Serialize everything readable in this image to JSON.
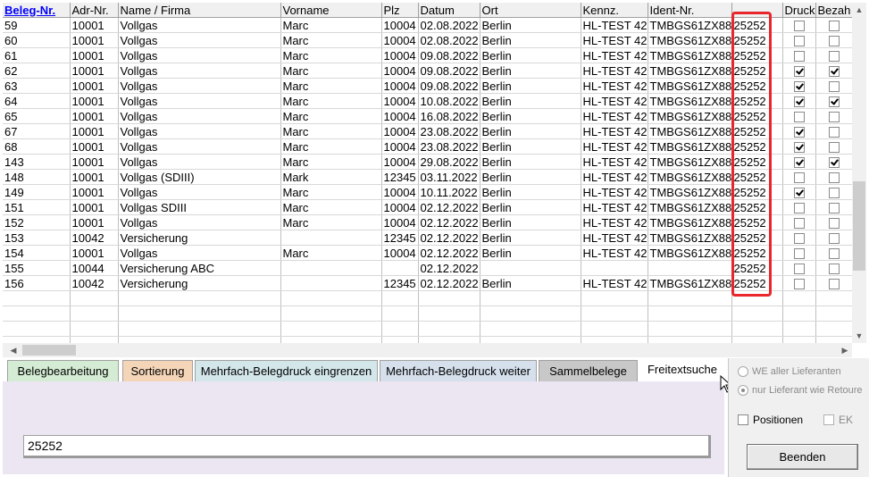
{
  "grid": {
    "columns": [
      "Beleg-Nr.",
      "Adr-Nr.",
      "Name / Firma",
      "Vorname",
      "Plz",
      "Datum",
      "Ort",
      "Kennz.",
      "Ident-Nr.",
      "",
      "Druck",
      "Bezah"
    ],
    "rows": [
      {
        "beleg": "59",
        "adr": "10001",
        "name": "Vollgas",
        "vorname": "Marc",
        "plz": "10004",
        "datum": "02.08.2022",
        "ort": "Berlin",
        "kennz": "HL-TEST 42",
        "ident": "TMBGS61ZX88",
        "value": "25252",
        "druck": false,
        "bezahlt": false
      },
      {
        "beleg": "60",
        "adr": "10001",
        "name": "Vollgas",
        "vorname": "Marc",
        "plz": "10004",
        "datum": "02.08.2022",
        "ort": "Berlin",
        "kennz": "HL-TEST 42",
        "ident": "TMBGS61ZX88",
        "value": "25252",
        "druck": false,
        "bezahlt": false
      },
      {
        "beleg": "61",
        "adr": "10001",
        "name": "Vollgas",
        "vorname": "Marc",
        "plz": "10004",
        "datum": "09.08.2022",
        "ort": "Berlin",
        "kennz": "HL-TEST 42",
        "ident": "TMBGS61ZX88",
        "value": "25252",
        "druck": false,
        "bezahlt": false
      },
      {
        "beleg": "62",
        "adr": "10001",
        "name": "Vollgas",
        "vorname": "Marc",
        "plz": "10004",
        "datum": "09.08.2022",
        "ort": "Berlin",
        "kennz": "HL-TEST 42",
        "ident": "TMBGS61ZX88",
        "value": "25252",
        "druck": true,
        "bezahlt": true
      },
      {
        "beleg": "63",
        "adr": "10001",
        "name": "Vollgas",
        "vorname": "Marc",
        "plz": "10004",
        "datum": "09.08.2022",
        "ort": "Berlin",
        "kennz": "HL-TEST 42",
        "ident": "TMBGS61ZX88",
        "value": "25252",
        "druck": true,
        "bezahlt": false
      },
      {
        "beleg": "64",
        "adr": "10001",
        "name": "Vollgas",
        "vorname": "Marc",
        "plz": "10004",
        "datum": "10.08.2022",
        "ort": "Berlin",
        "kennz": "HL-TEST 42",
        "ident": "TMBGS61ZX88",
        "value": "25252",
        "druck": true,
        "bezahlt": true
      },
      {
        "beleg": "65",
        "adr": "10001",
        "name": "Vollgas",
        "vorname": "Marc",
        "plz": "10004",
        "datum": "16.08.2022",
        "ort": "Berlin",
        "kennz": "HL-TEST 42",
        "ident": "TMBGS61ZX88",
        "value": "25252",
        "druck": false,
        "bezahlt": false
      },
      {
        "beleg": "67",
        "adr": "10001",
        "name": "Vollgas",
        "vorname": "Marc",
        "plz": "10004",
        "datum": "23.08.2022",
        "ort": "Berlin",
        "kennz": "HL-TEST 42",
        "ident": "TMBGS61ZX88",
        "value": "25252",
        "druck": true,
        "bezahlt": false
      },
      {
        "beleg": "68",
        "adr": "10001",
        "name": "Vollgas",
        "vorname": "Marc",
        "plz": "10004",
        "datum": "23.08.2022",
        "ort": "Berlin",
        "kennz": "HL-TEST 42",
        "ident": "TMBGS61ZX88",
        "value": "25252",
        "druck": true,
        "bezahlt": false
      },
      {
        "beleg": "143",
        "adr": "10001",
        "name": "Vollgas",
        "vorname": "Marc",
        "plz": "10004",
        "datum": "29.08.2022",
        "ort": "Berlin",
        "kennz": "HL-TEST 42",
        "ident": "TMBGS61ZX88",
        "value": "25252",
        "druck": true,
        "bezahlt": true
      },
      {
        "beleg": "148",
        "adr": "10001",
        "name": "Vollgas (SDIII)",
        "vorname": "Mark",
        "plz": "12345",
        "datum": "03.11.2022",
        "ort": "Berlin",
        "kennz": "HL-TEST 42",
        "ident": "TMBGS61ZX88",
        "value": "25252",
        "druck": false,
        "bezahlt": false
      },
      {
        "beleg": "149",
        "adr": "10001",
        "name": "Vollgas",
        "vorname": "Marc",
        "plz": "10004",
        "datum": "10.11.2022",
        "ort": "Berlin",
        "kennz": "HL-TEST 42",
        "ident": "TMBGS61ZX88",
        "value": "25252",
        "druck": true,
        "bezahlt": false
      },
      {
        "beleg": "151",
        "adr": "10001",
        "name": "Vollgas SDIII",
        "vorname": "Marc",
        "plz": "10004",
        "datum": "02.12.2022",
        "ort": "Berlin",
        "kennz": "HL-TEST 42",
        "ident": "TMBGS61ZX88",
        "value": "25252",
        "druck": false,
        "bezahlt": false
      },
      {
        "beleg": "152",
        "adr": "10001",
        "name": "Vollgas",
        "vorname": "Marc",
        "plz": "10004",
        "datum": "02.12.2022",
        "ort": "Berlin",
        "kennz": "HL-TEST 42",
        "ident": "TMBGS61ZX88",
        "value": "25252",
        "druck": false,
        "bezahlt": false
      },
      {
        "beleg": "153",
        "adr": "10042",
        "name": "Versicherung",
        "vorname": "",
        "plz": "12345",
        "datum": "02.12.2022",
        "ort": "Berlin",
        "kennz": "HL-TEST 42",
        "ident": "TMBGS61ZX88",
        "value": "25252",
        "druck": false,
        "bezahlt": false
      },
      {
        "beleg": "154",
        "adr": "10001",
        "name": "Vollgas",
        "vorname": "Marc",
        "plz": "10004",
        "datum": "02.12.2022",
        "ort": "Berlin",
        "kennz": "HL-TEST 42",
        "ident": "TMBGS61ZX88",
        "value": "25252",
        "druck": false,
        "bezahlt": false
      },
      {
        "beleg": "155",
        "adr": "10044",
        "name": "Versicherung ABC",
        "vorname": "",
        "plz": "",
        "datum": "02.12.2022",
        "ort": "",
        "kennz": "",
        "ident": "",
        "value": "25252",
        "druck": false,
        "bezahlt": false
      },
      {
        "beleg": "156",
        "adr": "10042",
        "name": "Versicherung",
        "vorname": "",
        "plz": "12345",
        "datum": "02.12.2022",
        "ort": "Berlin",
        "kennz": "HL-TEST 42",
        "ident": "TMBGS61ZX88",
        "value": "25252",
        "druck": false,
        "bezahlt": false
      }
    ],
    "empty_rows": 4,
    "highlight_color": "#e8262b"
  },
  "tabs": [
    {
      "label": "Belegbearbeitung",
      "color": "#d4ecd4"
    },
    {
      "label": "Sortierung",
      "color": "#f5d5b8"
    },
    {
      "label": "Mehrfach-Belegdruck eingrenzen",
      "color": "#d3e6ea"
    },
    {
      "label": "Mehrfach-Belegdruck weiter",
      "color": "#d5e0ec"
    },
    {
      "label": "Sammelbelege",
      "color": "#c8c8c8"
    },
    {
      "label": "Freitextsuche",
      "color": "#ffffff"
    }
  ],
  "search": {
    "value": "25252"
  },
  "options": {
    "we_all": "WE aller Lieferanten",
    "only_supplier": "nur Lieferant wie Retoure",
    "positionen": "Positionen",
    "ek": "EK",
    "end_button": "Beenden"
  }
}
